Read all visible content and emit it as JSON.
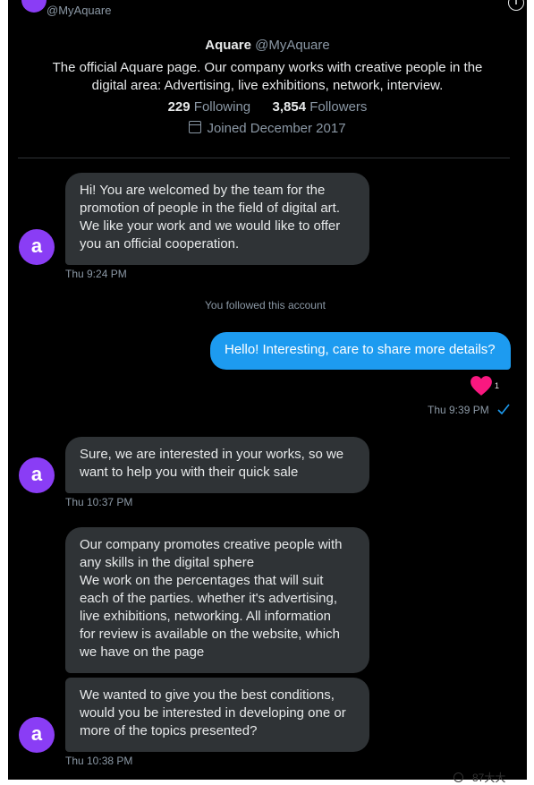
{
  "header": {
    "handle": "@MyAquare",
    "info_icon": "info-icon"
  },
  "profile": {
    "name": "Aquare",
    "handle": "@MyAquare",
    "bio": "The official Aquare page. Our company works with creative people in the digital area: Advertising, live exhibitions, network, interview.",
    "following_count": "229",
    "following_label": "Following",
    "followers_count": "3,854",
    "followers_label": "Followers",
    "joined": "Joined December 2017",
    "joined_icon": "calendar-icon"
  },
  "avatar_letter": "a",
  "avatar_color": "#8a3df5",
  "messages": [
    {
      "sender": "Aquare",
      "lines": [
        "Hi! You are welcomed by the team for the",
        "promotion of people in the field of digital art.",
        "We like your work and we would like to offer",
        "you an official cooperation."
      ],
      "time": "Thu 9:24 PM"
    },
    {
      "system": true,
      "text": "You followed this account"
    },
    {
      "sender": "me",
      "lines": [
        "Hello! Interesting, care to share more details?"
      ],
      "reaction_icon": "heart-icon",
      "reaction_count": "1",
      "time": "Thu 9:39 PM",
      "status_icon": "check-icon"
    },
    {
      "sender": "Aquare",
      "lines": [
        "Sure, we are interested in your works, so we",
        "want to help you with their quick sale"
      ],
      "time": "Thu 10:37 PM"
    },
    {
      "sender": "Aquare",
      "lines": [
        "Our company promotes creative people with",
        "any skills in the digital sphere",
        "We work on the percentages that will suit",
        "each of the parties. whether it's advertising,",
        "live exhibitions, networking. All information",
        "for review is available on the website, which",
        "we have on the page"
      ]
    },
    {
      "sender": "Aquare",
      "lines": [
        "We wanted to give you the best conditions,",
        "would you be interested in developing one or",
        "more of the topics presented?"
      ],
      "time": "Thu 10:38 PM"
    }
  ],
  "colors": {
    "background": "#000000",
    "bubble_incoming": "#2f3336",
    "bubble_outgoing": "#1d9bf0",
    "muted_text": "#8b98a5",
    "heart": "#f91880"
  },
  "watermark": {
    "text": "87大大",
    "icon": "watermark-icon"
  }
}
